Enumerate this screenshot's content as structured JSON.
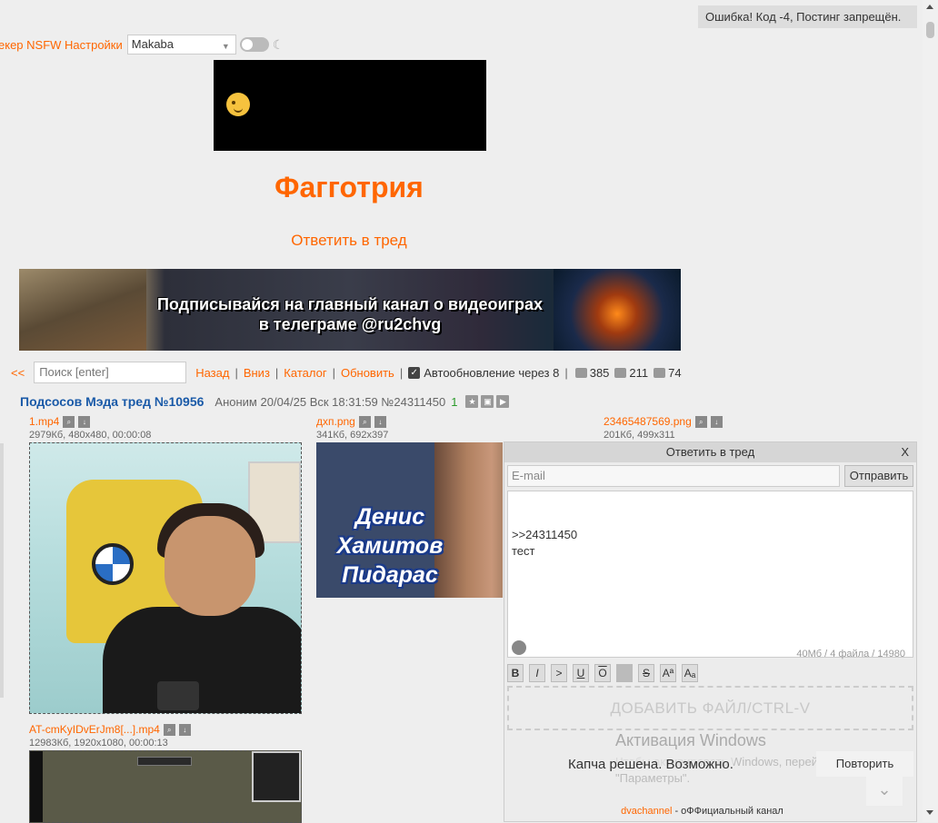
{
  "error_banner": "Ошибка! Код -4, Постинг запрещён.",
  "top_bar": {
    "links": "екер NSFW Настройки",
    "style_select": "Makaba"
  },
  "board": {
    "title": "Фагготрия",
    "reply_link": "Ответить в тред"
  },
  "promo_banner": {
    "line1": "Подписывайся на главный канал о видеоиграх",
    "line2": "в телеграме @ru2chvg"
  },
  "nav": {
    "back": "<<",
    "search_placeholder": "Поиск [enter]",
    "links": [
      "Назад",
      "Вниз",
      "Каталог",
      "Обновить"
    ],
    "auto_update": "Автообновление через 8",
    "posts_count": "385",
    "images_count": "211",
    "users_count": "74"
  },
  "thread": {
    "title": "Подсосов Мэда тред №10956",
    "author": "Аноним",
    "datetime": "20/04/25 Вск 18:31:59",
    "post_number": "№24311450",
    "post_index": "1"
  },
  "files": [
    {
      "name": "1.mp4",
      "meta": "2979Кб, 480x480, 00:00:08"
    },
    {
      "name": "дхп.png",
      "meta": "341Кб, 692x397"
    },
    {
      "name": "23465487569.png",
      "meta": "201Кб, 499x311"
    },
    {
      "name": "AT-cmKyIDvErJm8[...].mp4",
      "meta": "12983Кб, 1920x1080, 00:00:13"
    }
  ],
  "thumb2_text": "Денис\nХамитов\nПидарас",
  "reply_form": {
    "header": "Ответить в тред",
    "close": "X",
    "email_placeholder": "E-mail",
    "send": "Отправить",
    "message": ">>24311450\nтест",
    "limits": "40Мб / 4 файла / 14980",
    "format_buttons": [
      "B",
      "I",
      ">",
      "U",
      "O",
      "",
      "S",
      "Aª",
      "Aₐ"
    ],
    "add_file": "ДОБАВИТЬ ФАЙЛ/CTRL-V",
    "windows_activation": "Активация Windows",
    "windows_sub": "Чтобы активировать Windows, перейдите в раздел \"Параметры\".",
    "captcha_status": "Капча решена. Возможно.",
    "retry": "Повторить",
    "channel_link": "dvachannel",
    "channel_suffix": " - оФФициальный канал"
  },
  "colors": {
    "accent": "#ff6600",
    "thread_title": "#1a5aa8",
    "background": "#eeeeee"
  }
}
